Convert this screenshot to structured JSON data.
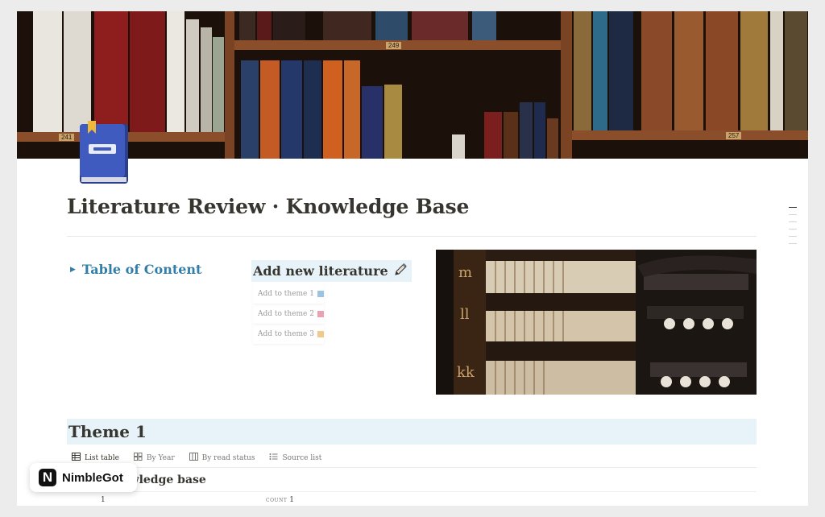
{
  "page": {
    "title": "Literature Review · Knowledge Base",
    "icon": "book-icon"
  },
  "cover": {
    "shelf_labels": [
      "241",
      "249",
      "257"
    ]
  },
  "toc": {
    "label": "Table of Content",
    "icon": "toggle-triangle-icon"
  },
  "add_literature": {
    "label": "Add new literature",
    "icon": "pencil-icon",
    "buttons": [
      {
        "label": "Add to theme 1",
        "color": "#9cc3e0"
      },
      {
        "label": "Add to theme 2",
        "color": "#e8a3b3"
      },
      {
        "label": "Add to theme 3",
        "color": "#f0c98c"
      }
    ]
  },
  "theme": {
    "heading": "Theme 1",
    "views": [
      {
        "label": "List table",
        "icon": "table-icon",
        "active": true
      },
      {
        "label": "By Year",
        "icon": "grid-icon",
        "active": false
      },
      {
        "label": "By read status",
        "icon": "board-icon",
        "active": false
      },
      {
        "label": "Source list",
        "icon": "list-icon",
        "active": false
      }
    ],
    "database_title": "nowledge base",
    "row_count": "1",
    "count_label": "COUNT",
    "count_value": "1"
  },
  "watermark": {
    "logo": "N",
    "name": "NimbleGot"
  },
  "colors": {
    "accent_blue": "#337ea9",
    "callout_bg": "#e7f3f8",
    "text": "#37352f"
  }
}
